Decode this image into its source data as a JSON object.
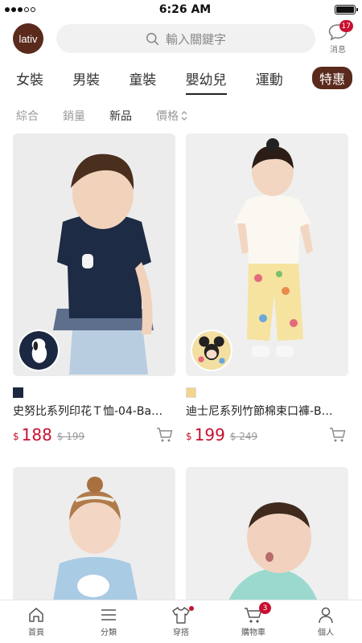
{
  "status": {
    "time": "6:26 AM"
  },
  "header": {
    "logo": "lativ",
    "search_placeholder": "輸入關鍵字",
    "messages": {
      "label": "消息",
      "badge": "17"
    }
  },
  "categories": [
    "女裝",
    "男裝",
    "童裝",
    "嬰幼兒",
    "運動"
  ],
  "sale_tab": "特惠",
  "sort": {
    "items": [
      "綜合",
      "銷量",
      "新品"
    ],
    "price": "價格"
  },
  "products": [
    {
      "name": "史努比系列印花Ｔ恤-04-Ba…",
      "currency": "$",
      "price": "188",
      "original": "$ 199",
      "swatch": "#1c2741"
    },
    {
      "name": "迪士尼系列竹節棉束口褲-B…",
      "currency": "$",
      "price": "199",
      "original": "$ 249",
      "swatch": "#f2d48a"
    }
  ],
  "bottom_nav": [
    {
      "label": "首頁",
      "icon": "home-icon"
    },
    {
      "label": "分類",
      "icon": "menu-icon"
    },
    {
      "label": "穿搭",
      "icon": "shirt-icon"
    },
    {
      "label": "購物車",
      "icon": "cart-icon",
      "badge": "3"
    },
    {
      "label": "個人",
      "icon": "user-icon"
    }
  ],
  "colors": {
    "brand": "#5a2a1c",
    "price": "#c8102e"
  }
}
